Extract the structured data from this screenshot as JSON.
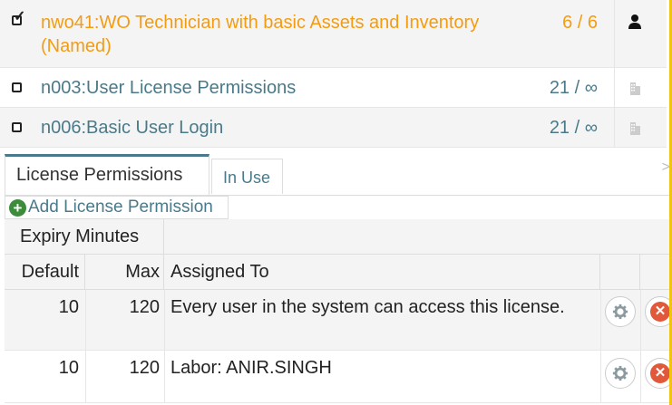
{
  "licenses": [
    {
      "name": "nwo41:WO Technician with basic Assets and Inventory (Named)",
      "count": "6 / 6",
      "checked": true,
      "icon": "person-icon"
    },
    {
      "name": "n003:User License Permissions",
      "count": "21 / ∞",
      "checked": false,
      "icon": "building-icon"
    },
    {
      "name": "n006:Basic User Login",
      "count": "21 / ∞",
      "checked": false,
      "icon": "building-icon"
    }
  ],
  "tabs": {
    "active": "License Permissions",
    "inactive": "In Use",
    "more": ">"
  },
  "add_button": {
    "label": "Add License Permission"
  },
  "grid": {
    "group_header": "Expiry Minutes",
    "columns": {
      "default": "Default",
      "max": "Max",
      "assigned": "Assigned To"
    },
    "rows": [
      {
        "default": "10",
        "max": "120",
        "assigned": "Every user in the system can access this license."
      },
      {
        "default": "10",
        "max": "120",
        "assigned": "Labor: ANIR.SINGH"
      }
    ]
  },
  "colors": {
    "selected": "#f39c12",
    "link": "#4a7a8a",
    "accent_edge": "#f1c40f",
    "delete": "#e2583b",
    "add": "#3c8c3c"
  }
}
